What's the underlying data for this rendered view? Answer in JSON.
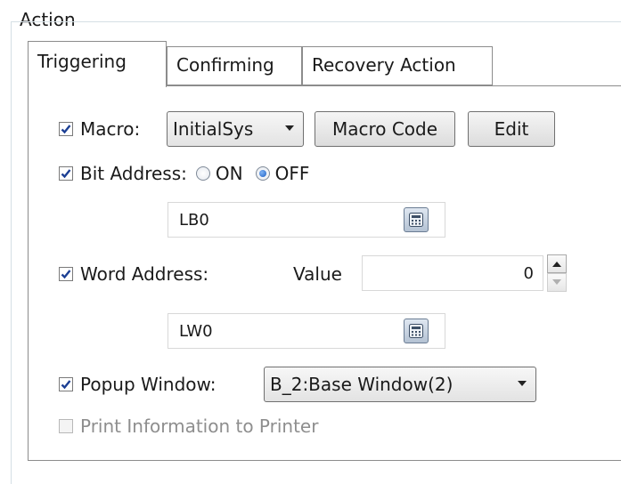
{
  "group": {
    "title": "Action"
  },
  "tabs": [
    {
      "label": "Triggering",
      "active": true
    },
    {
      "label": "Confirming",
      "active": false
    },
    {
      "label": "Recovery Action",
      "active": false
    }
  ],
  "macro": {
    "label": "Macro:",
    "checked": true,
    "selected": "InitialSys",
    "macro_code_button": "Macro Code",
    "edit_button": "Edit"
  },
  "bit_address": {
    "label": "Bit Address:",
    "checked": true,
    "options": [
      {
        "label": "ON",
        "selected": false
      },
      {
        "label": "OFF",
        "selected": true
      }
    ],
    "address": "LB0"
  },
  "word_address": {
    "label": "Word Address:",
    "checked": true,
    "value_label": "Value",
    "value": "0",
    "address": "LW0"
  },
  "popup_window": {
    "label": "Popup Window:",
    "checked": true,
    "selected": "B_2:Base Window(2)"
  },
  "print_info": {
    "label": "Print Information to Printer",
    "checked": false,
    "disabled": true
  },
  "colors": {
    "check_mark": "#1c3f94",
    "radio_selected": "#1d5fc4",
    "border": "#8c8c8c",
    "disabled_text": "#8e8e8e"
  }
}
